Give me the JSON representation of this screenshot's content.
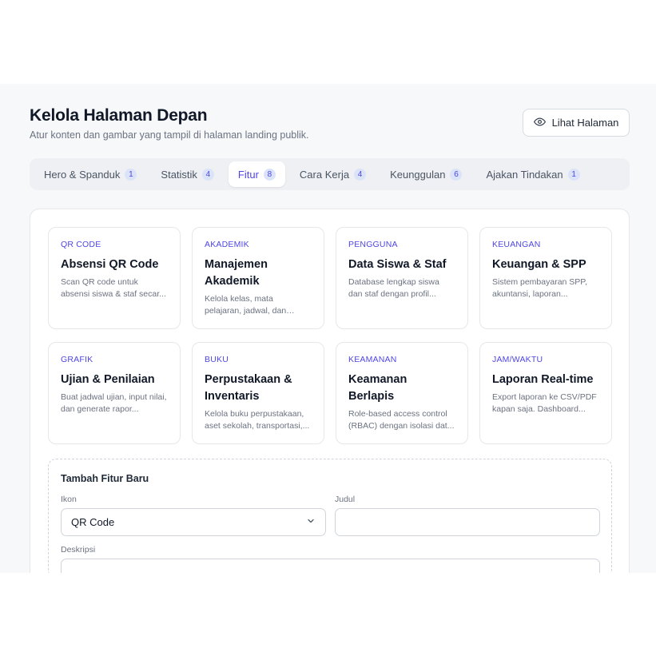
{
  "header": {
    "title": "Kelola Halaman Depan",
    "subtitle": "Atur konten dan gambar yang tampil di halaman landing publik.",
    "view_button": "Lihat Halaman",
    "view_icon": "eye-icon"
  },
  "tabs": [
    {
      "label": "Hero & Spanduk",
      "count": "1",
      "active": false
    },
    {
      "label": "Statistik",
      "count": "4",
      "active": false
    },
    {
      "label": "Fitur",
      "count": "8",
      "active": true
    },
    {
      "label": "Cara Kerja",
      "count": "4",
      "active": false
    },
    {
      "label": "Keunggulan",
      "count": "6",
      "active": false
    },
    {
      "label": "Ajakan Tindakan",
      "count": "1",
      "active": false
    }
  ],
  "features": [
    {
      "category": "QR CODE",
      "title": "Absensi QR Code",
      "desc": "Scan QR code untuk absensi siswa & staf secar..."
    },
    {
      "category": "AKADEMIK",
      "title": "Manajemen Akademik",
      "desc": "Kelola kelas, mata pelajaran, jadwal, dan penugasan gur..."
    },
    {
      "category": "PENGGUNA",
      "title": "Data Siswa & Staf",
      "desc": "Database lengkap siswa dan staf dengan profil..."
    },
    {
      "category": "KEUANGAN",
      "title": "Keuangan & SPP",
      "desc": "Sistem pembayaran SPP, akuntansi, laporan..."
    },
    {
      "category": "GRAFIK",
      "title": "Ujian & Penilaian",
      "desc": "Buat jadwal ujian, input nilai, dan generate rapor..."
    },
    {
      "category": "BUKU",
      "title": "Perpustakaan & Inventaris",
      "desc": "Kelola buku perpustakaan, aset sekolah, transportasi,..."
    },
    {
      "category": "KEAMANAN",
      "title": "Keamanan Berlapis",
      "desc": "Role-based access control (RBAC) dengan isolasi dat..."
    },
    {
      "category": "JAM/WAKTU",
      "title": "Laporan Real-time",
      "desc": "Export laporan ke CSV/PDF kapan saja. Dashboard..."
    }
  ],
  "add_form": {
    "title": "Tambah Fitur Baru",
    "icon_label": "Ikon",
    "icon_value": "QR Code",
    "title_label": "Judul",
    "title_value": "",
    "desc_label": "Deskripsi"
  },
  "colors": {
    "accent": "#4f46e5",
    "badge_bg": "#dbe3f8",
    "background": "#f7f8fa",
    "taskbar": "#202020"
  }
}
